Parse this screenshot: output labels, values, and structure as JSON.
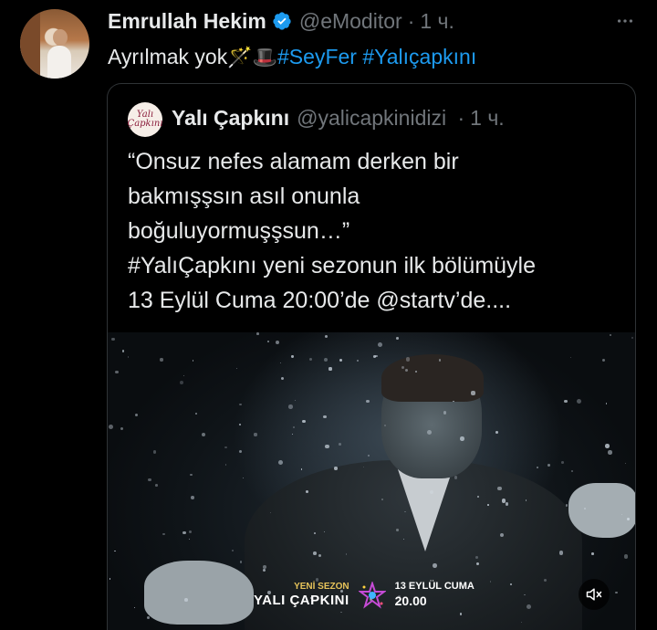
{
  "tweet": {
    "author_name": "Emrullah Hekim",
    "handle": "@eModitor",
    "separator": "·",
    "time": "1 ч.",
    "text_prefix": "Ayrılmak yok",
    "emojis": "🪄🎩",
    "hashtags": [
      "#SeyFer",
      "#Yalıçapkını"
    ],
    "more_icon": "more-horizontal-icon"
  },
  "quote": {
    "author_name": "Yalı Çapkını",
    "handle": "@yalicapkinidizi",
    "separator": "·",
    "time": "1 ч.",
    "avatar_text": [
      "Yalı",
      "Çapkını"
    ],
    "lines": [
      "“Onsuz nefes alamam derken bir",
      "bakmışşsın asıl onunla",
      "boğuluyormuşşsun…”",
      "#YalıÇapkını yeni sezonun ilk bölümüyle",
      "13 Eylül Cuma 20:00’de @startv’de...."
    ]
  },
  "media": {
    "brand_small": "YENİ SEZON",
    "brand_big": "YALI ÇAPKINI",
    "date": "13 EYLÜL CUMA",
    "time": "20.00",
    "mute_icon": "muted-speaker-icon"
  },
  "colors": {
    "background": "#000000",
    "text": "#e7e9ea",
    "secondary": "#71767b",
    "link": "#1d9bf0",
    "verified": "#1d9bf0",
    "border": "#2f3336"
  }
}
